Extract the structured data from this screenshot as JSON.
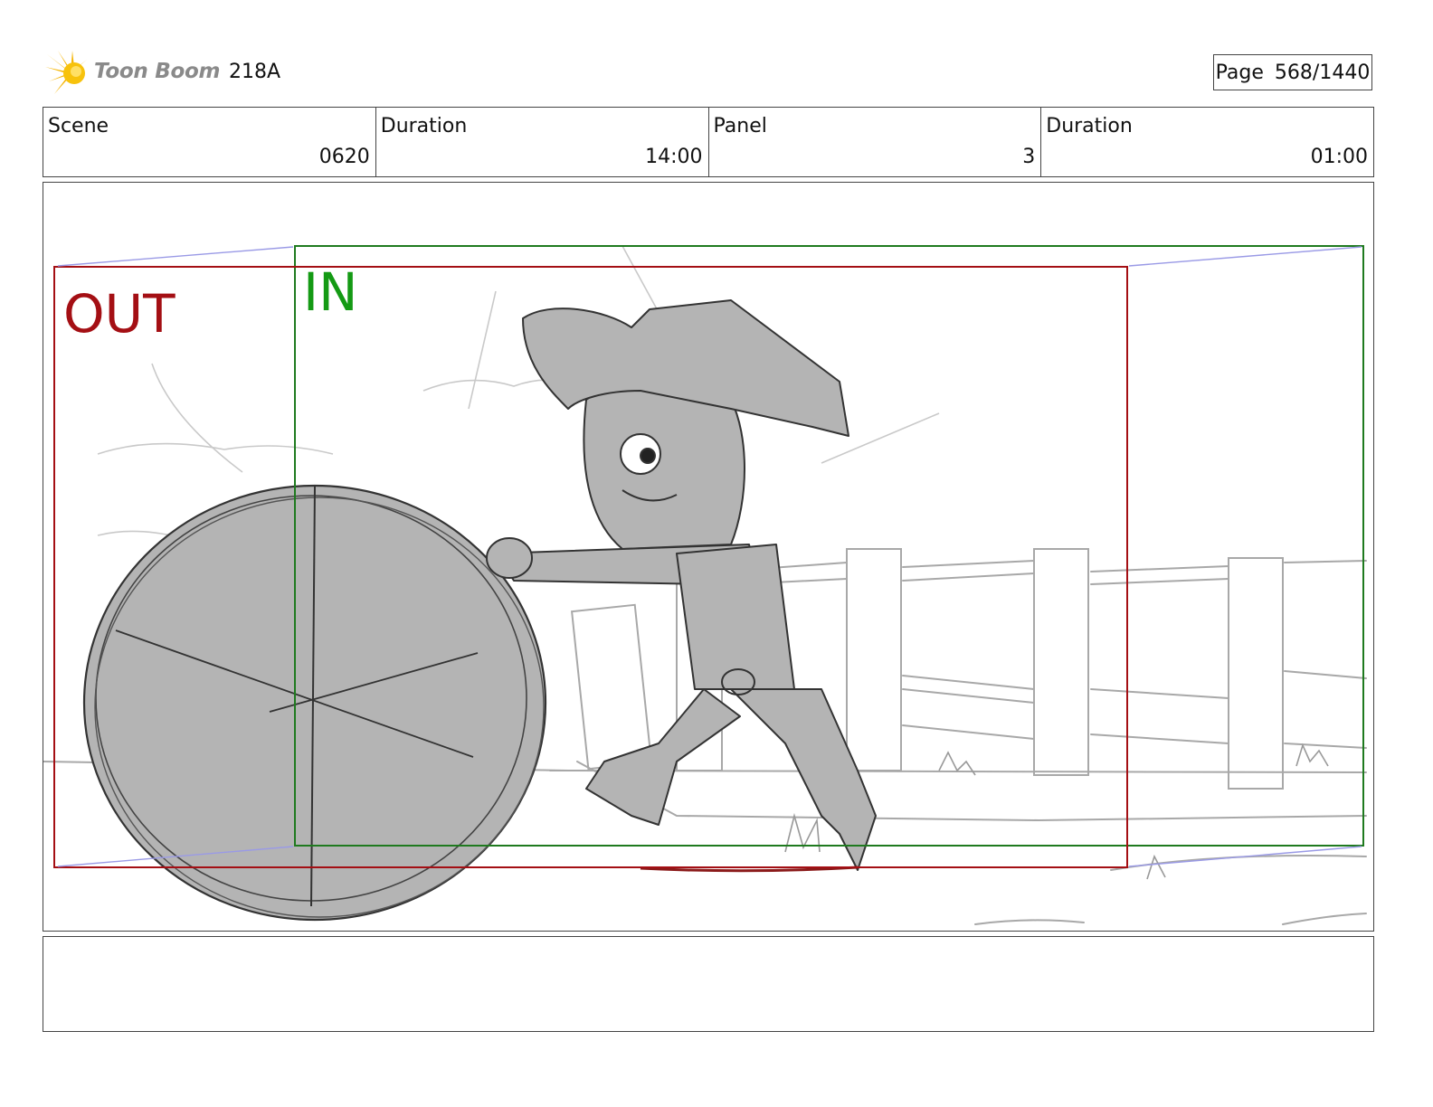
{
  "header": {
    "brand": "Toon Boom",
    "project_code": "218A",
    "page": {
      "label": "Page",
      "value": "568/1440"
    }
  },
  "info": {
    "scene": {
      "label": "Scene",
      "value": "0620"
    },
    "scene_duration": {
      "label": "Duration",
      "value": "14:00"
    },
    "panel": {
      "label": "Panel",
      "value": "3"
    },
    "panel_duration": {
      "label": "Duration",
      "value": "01:00"
    }
  },
  "panel_frames": {
    "out_label": "OUT",
    "in_label": "IN",
    "out_color": "#a40f14",
    "in_color": "#149a14",
    "guide_color": "#9a9ae6"
  },
  "notes": {
    "text": ""
  }
}
